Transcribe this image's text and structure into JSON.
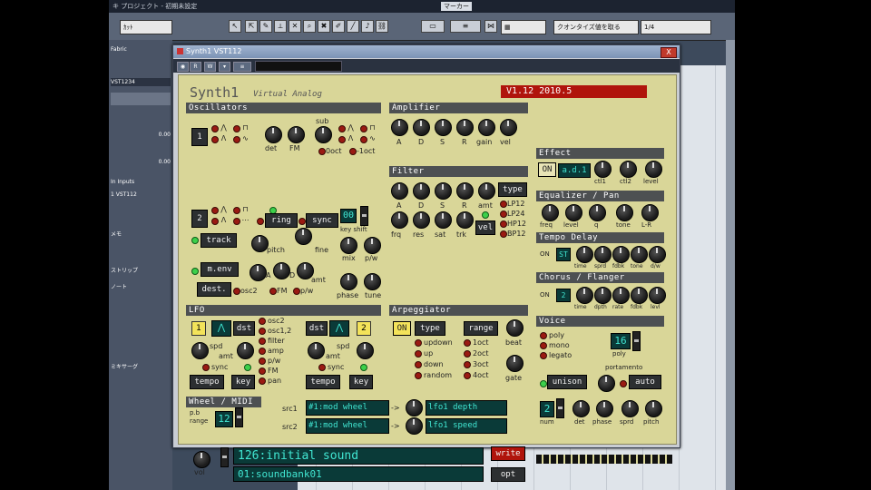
{
  "daw": {
    "window_title": "キ プロジェクト - 初期未設定",
    "marker_label": "マーカー",
    "tool_select": "ｶｯﾄ",
    "quantize_label": "クオンタイズ値を取る",
    "quantize_value": "1/4",
    "project_label": "Fabric",
    "inspector": {
      "track_name": "VST1234",
      "value1": "0.00",
      "value2": "0.00",
      "input_label": "In Inputs",
      "instrument_label": "1 VST112",
      "folder_label": "メモ",
      "section2": "ストリップ",
      "section3": "ノート",
      "section4": "ミキサーグ"
    }
  },
  "plugin": {
    "title": "Synth1 VST112",
    "close_label": "X",
    "logo": "Synth1",
    "subtitle": "Virtual Analog",
    "version": "V1.12 2010.5",
    "sections": {
      "oscillators": "Oscillators",
      "amplifier": "Amplifier",
      "filter": "Filter",
      "lfo": "LFO",
      "arpeggiator": "Arpeggiator",
      "wheel": "Wheel / MIDI",
      "effect": "Effect",
      "eq": "Equalizer / Pan",
      "delay": "Tempo Delay",
      "chorus": "Chorus / Flanger",
      "voice": "Voice"
    },
    "osc": {
      "osc1_num": "1",
      "osc2_num": "2",
      "det": "det",
      "fm": "FM",
      "sub": "sub",
      "oct0": "0oct",
      "oct_minus": "-1oct",
      "ring": "ring",
      "sync": "sync",
      "track": "track",
      "pitch": "pitch",
      "fine": "fine",
      "key_shift_label": "key shift",
      "key_shift_value": "00",
      "mix": "mix",
      "pw": "p/w",
      "menv": "m.env",
      "dest": "dest.",
      "a": "A",
      "d": "D",
      "amt": "amt",
      "osc2_dest": "osc2",
      "fm_dest": "FM",
      "pw_dest": "p/w",
      "phase": "phase",
      "tune": "tune"
    },
    "amp": {
      "a": "A",
      "d": "D",
      "s": "S",
      "r": "R",
      "gain": "gain",
      "vel": "vel"
    },
    "filt": {
      "a": "A",
      "d": "D",
      "s": "S",
      "r": "R",
      "amt": "amt",
      "type": "type",
      "frq": "frq",
      "res": "res",
      "sat": "sat",
      "trk": "trk",
      "vel": "vel",
      "lp12": "LP12",
      "lp24": "LP24",
      "hp12": "HP12",
      "bp12": "BP12"
    },
    "lfo": {
      "lfo1": "1",
      "lfo2": "2",
      "dst": "dst",
      "spd": "spd",
      "amt": "amt",
      "sync": "sync",
      "tempo": "tempo",
      "key": "key",
      "dests": [
        "osc2",
        "osc1,2",
        "filter",
        "amp",
        "p/w",
        "FM",
        "pan"
      ]
    },
    "arp": {
      "on": "ON",
      "type": "type",
      "range": "range",
      "beat": "beat",
      "gate": "gate",
      "types": [
        "updown",
        "up",
        "down",
        "random"
      ],
      "ranges": [
        "1oct",
        "2oct",
        "3oct",
        "4oct"
      ]
    },
    "wheel": {
      "pb_range": "p.b\nrange",
      "pb_value": "12",
      "src1": "src1",
      "src2": "src2",
      "src1_value": "#1:mod wheel",
      "src2_value": "#1:mod wheel",
      "dst1_value": "lfo1 depth",
      "dst2_value": "lfo1 speed",
      "arrow": "->"
    },
    "patch": {
      "vol": "vol",
      "name": "126:initial sound",
      "bank": "01:soundbank01",
      "write": "write",
      "opt": "opt"
    },
    "effect": {
      "on": "ON",
      "type": "a.d.1",
      "ctl1": "ctl1",
      "ctl2": "ctl2",
      "level": "level"
    },
    "eq": {
      "freq": "freq",
      "level": "level",
      "q": "q",
      "tone": "tone",
      "lr": "L-R"
    },
    "delay": {
      "on": "ON",
      "type": "ST",
      "time": "time",
      "sprd": "sprd",
      "fdbk": "fdbk",
      "tone": "tone",
      "dw": "d/w"
    },
    "chorus": {
      "on": "ON",
      "type": "2",
      "time": "time",
      "dpth": "dpth",
      "rate": "rate",
      "fdbk": "fdbk",
      "levl": "levl"
    },
    "voice": {
      "poly": "poly",
      "mono": "mono",
      "legato": "legato",
      "poly_label": "poly",
      "poly_value": "16",
      "portamento": "portamento",
      "unison": "unison",
      "auto": "auto",
      "num_label": "num",
      "num_value": "2",
      "det": "det",
      "phase": "phase",
      "sprd": "sprd",
      "pitch": "pitch"
    }
  }
}
